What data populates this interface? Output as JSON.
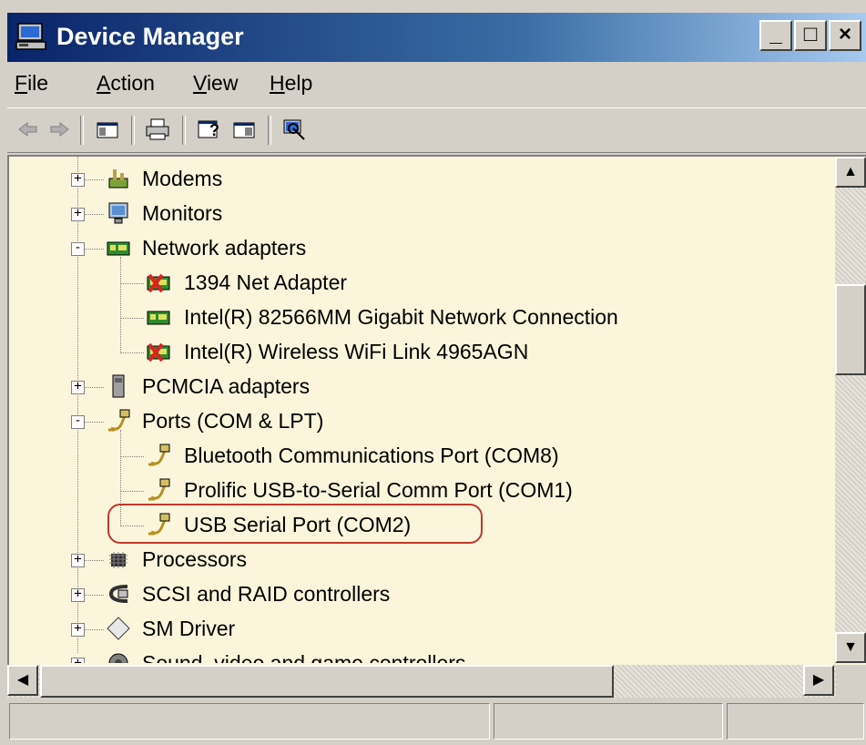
{
  "window": {
    "title": "Device Manager",
    "controls": {
      "minimize": "_",
      "maximize": "□",
      "close": "×"
    }
  },
  "menu": {
    "items": [
      {
        "mnemonic": "F",
        "rest": "ile"
      },
      {
        "mnemonic": "A",
        "rest": "ction"
      },
      {
        "mnemonic": "V",
        "rest": "iew"
      },
      {
        "mnemonic": "H",
        "rest": "elp"
      }
    ]
  },
  "toolbar": {
    "buttons": [
      "back-icon",
      "forward-icon",
      "show-hide-tree-icon",
      "print-icon",
      "help-icon",
      "properties-icon",
      "scan-hardware-icon"
    ]
  },
  "tree": {
    "items": [
      {
        "label": "Modems",
        "icon": "modem-icon",
        "level": 0,
        "expander": "+"
      },
      {
        "label": "Monitors",
        "icon": "monitor-icon",
        "level": 0,
        "expander": "+"
      },
      {
        "label": "Network adapters",
        "icon": "network-adapter-icon",
        "level": 0,
        "expander": "-"
      },
      {
        "label": "1394 Net Adapter",
        "icon": "network-adapter-disabled-icon",
        "level": 1,
        "expander": ""
      },
      {
        "label": "Intel(R) 82566MM Gigabit Network Connection",
        "icon": "network-adapter-icon",
        "level": 1,
        "expander": ""
      },
      {
        "label": "Intel(R) Wireless WiFi Link 4965AGN",
        "icon": "network-adapter-disabled-icon",
        "level": 1,
        "expander": ""
      },
      {
        "label": "PCMCIA adapters",
        "icon": "pcmcia-icon",
        "level": 0,
        "expander": "+"
      },
      {
        "label": "Ports (COM & LPT)",
        "icon": "port-icon",
        "level": 0,
        "expander": "-"
      },
      {
        "label": "Bluetooth Communications Port (COM8)",
        "icon": "port-icon",
        "level": 1,
        "expander": ""
      },
      {
        "label": "Prolific USB-to-Serial Comm Port (COM1)",
        "icon": "port-icon",
        "level": 1,
        "expander": ""
      },
      {
        "label": "USB Serial Port (COM2)",
        "icon": "port-icon",
        "level": 1,
        "expander": "",
        "highlighted": true
      },
      {
        "label": "Processors",
        "icon": "processor-icon",
        "level": 0,
        "expander": "+"
      },
      {
        "label": "SCSI and RAID controllers",
        "icon": "scsi-icon",
        "level": 0,
        "expander": "+"
      },
      {
        "label": "SM Driver",
        "icon": "sm-driver-icon",
        "level": 0,
        "expander": "+"
      },
      {
        "label": "Sound, video and game controllers",
        "icon": "sound-icon",
        "level": 0,
        "expander": "+"
      }
    ]
  },
  "scrollbars": {
    "vertical": {
      "up": "▲",
      "down": "▼"
    },
    "horizontal": {
      "left": "◀",
      "right": "▶"
    }
  },
  "colors": {
    "titlebar_start": "#0a246a",
    "titlebar_end": "#a6caf0",
    "tree_background": "#fbf5dc",
    "highlight_border": "#c0392b"
  }
}
